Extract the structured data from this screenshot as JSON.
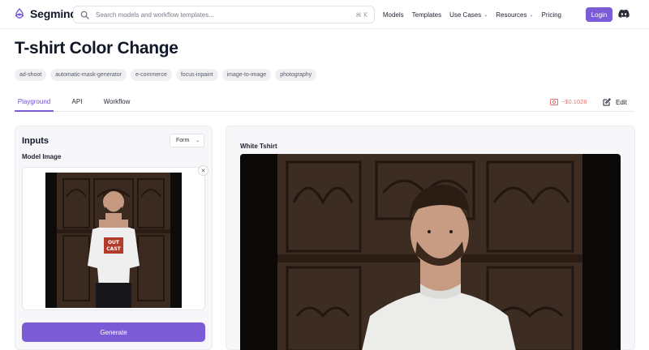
{
  "nav": {
    "logo_text": "Segmind",
    "search_placeholder": "Search models and workflow templates...",
    "search_shortcut": "⌘ K",
    "links": [
      {
        "label": "Models"
      },
      {
        "label": "Templates"
      },
      {
        "label": "Use Cases"
      },
      {
        "label": "Resources"
      },
      {
        "label": "Pricing"
      }
    ],
    "login_label": "Login"
  },
  "page": {
    "title": "T-shirt Color Change",
    "tags": [
      "ad-shoot",
      "automatic-mask-generator",
      "e-commerce",
      "focus-inpaint",
      "image-to-image",
      "photography"
    ],
    "tabs": [
      "Playground",
      "API",
      "Workflow"
    ],
    "active_tab": "Playground",
    "cost": "~$0.1028",
    "edit_label": "Edit"
  },
  "inputs": {
    "title": "Inputs",
    "mode_select": "Form",
    "model_image_label": "Model Image",
    "thumbnail_print_line1": "OUT",
    "thumbnail_print_line2": "CAST",
    "generate_label": "Generate"
  },
  "output": {
    "label": "White Tshirt"
  },
  "colors": {
    "accent": "#7c5bd6",
    "cost_text": "#e57373",
    "panel_bg": "#f7f7f9"
  }
}
